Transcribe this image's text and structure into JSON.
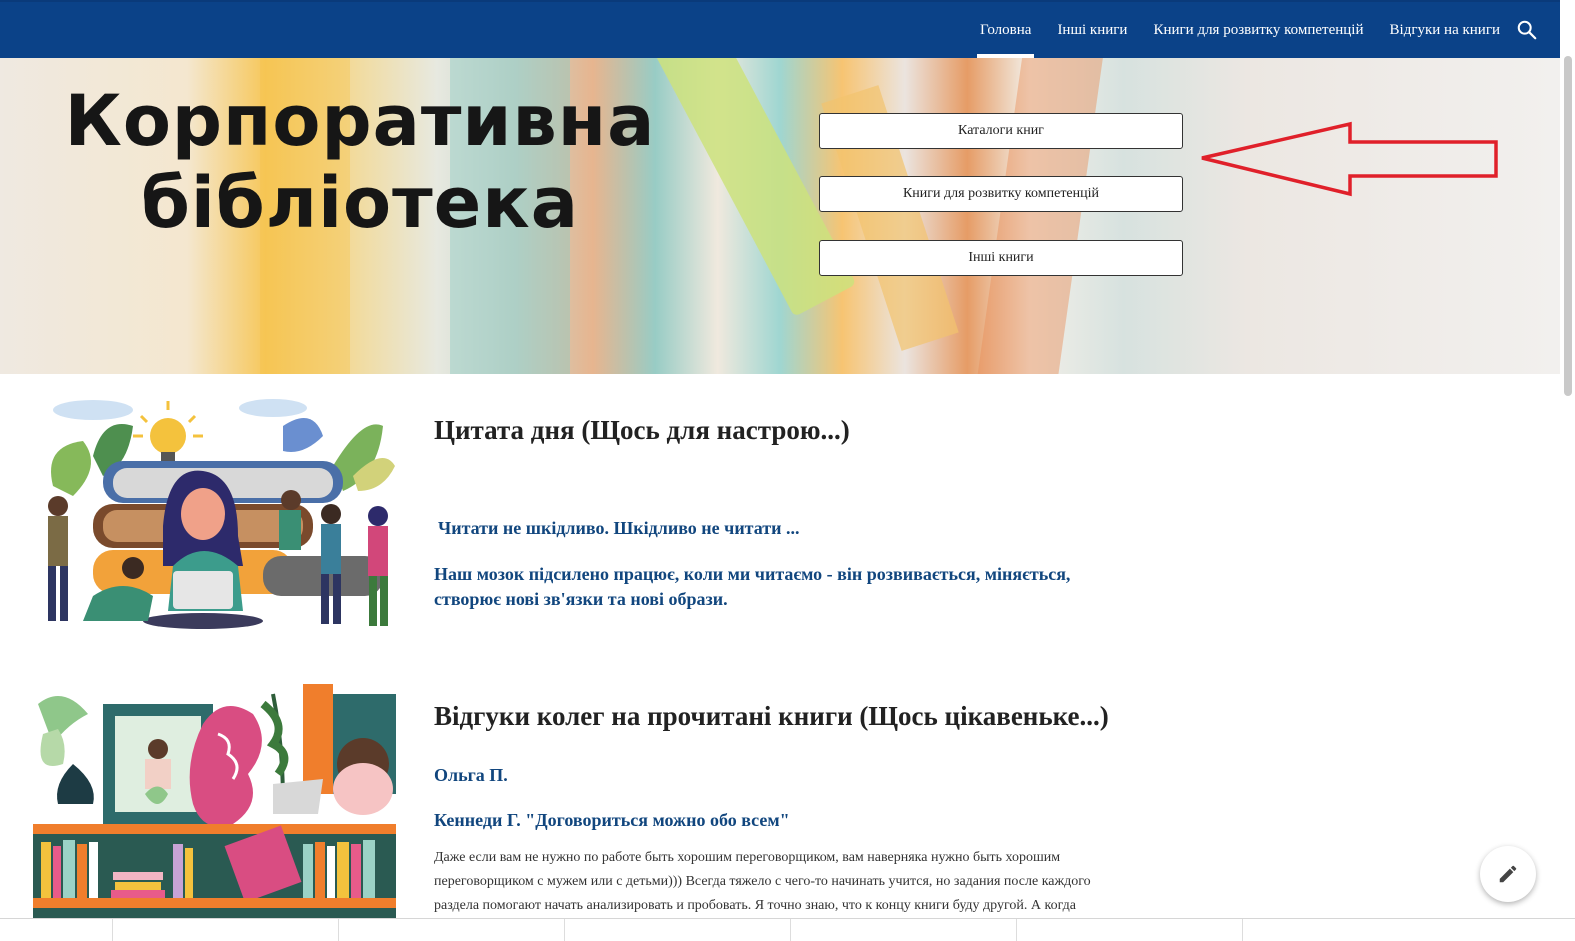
{
  "nav": {
    "items": [
      {
        "label": "Головна",
        "active": true
      },
      {
        "label": "Інші книги",
        "active": false
      },
      {
        "label": "Книги для розвитку компетенцій",
        "active": false
      },
      {
        "label": "Відгуки на книги",
        "active": false
      }
    ],
    "search_icon": "search-icon"
  },
  "hero": {
    "title_line1": "Корпоративна",
    "title_line2": "бібліотека",
    "buttons": [
      "Каталоги книг",
      "Книги для розвитку компетенцій",
      "Інші книги"
    ]
  },
  "section1": {
    "heading": "Цитата дня (Щось для настрою...)",
    "quote1": "Читати не шкідливо. Шкідливо не читати ...",
    "quote2_line1": "Наш мозок підсилено працює, коли ми читаємо - він розвивається, міняється,",
    "quote2_line2": "створює нові зв'язки та нові образи."
  },
  "section2": {
    "heading": "Відгуки колег на прочитані книги (Щось цікавеньке...)",
    "author": "Ольга П.",
    "book": "Кеннеди Г. \"Договориться можно обо всем\"",
    "text_line1": "Даже если вам не нужно по работе быть хорошим переговорщиком, вам наверняка нужно быть хорошим",
    "text_line2": "переговорщиком с мужем или с детьми))) Всегда тяжело с чего-то начинать учится, но задания после каждого",
    "text_line3": "раздела помогают начать анализировать и пробовать. Я точно знаю, что к концу книги буду другой. А когда"
  },
  "colors": {
    "nav_bg": "#0b4288",
    "quote": "#11467e",
    "arrow": "#e0202a"
  },
  "icons": {
    "edit": "pencil-icon"
  }
}
